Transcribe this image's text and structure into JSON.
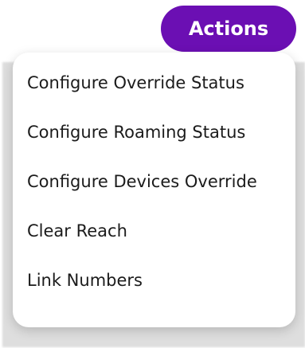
{
  "actions_button": {
    "label": "Actions",
    "color": "#6b0fb3"
  },
  "menu": {
    "items": [
      {
        "label": "Configure Override Status"
      },
      {
        "label": "Configure Roaming Status"
      },
      {
        "label": "Configure Devices Override"
      },
      {
        "label": "Clear Reach"
      },
      {
        "label": "Link Numbers"
      }
    ]
  }
}
